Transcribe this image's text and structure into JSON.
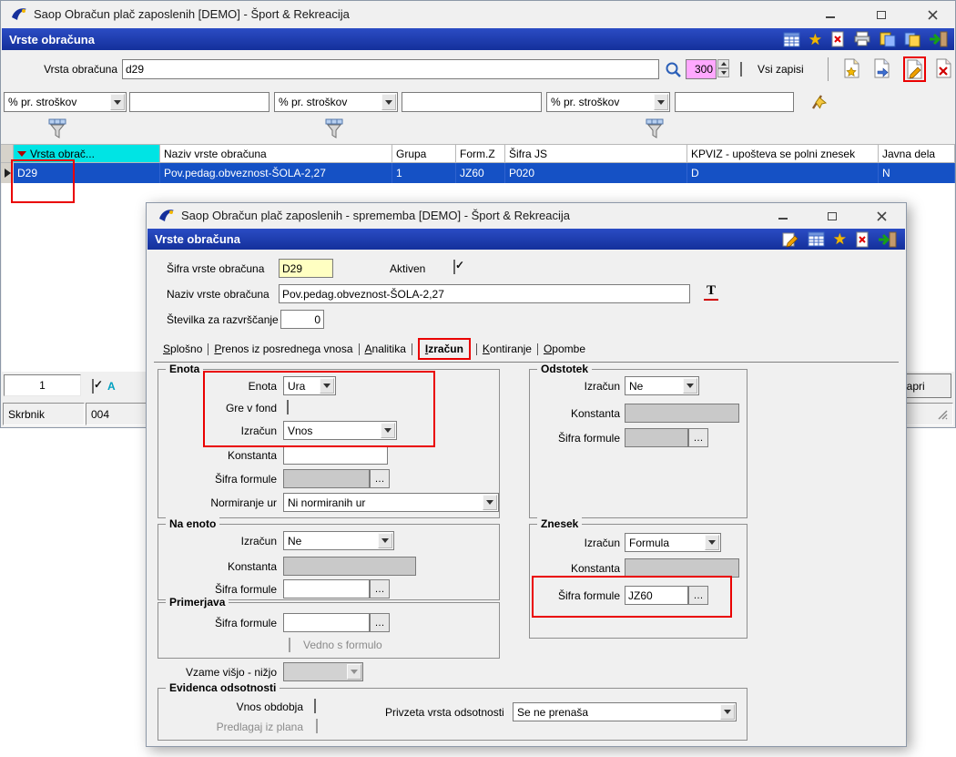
{
  "ui": {
    "ellipsis": "…",
    "t_glyph": "T"
  },
  "main_window": {
    "title": "Saop Obračun plač zaposlenih [DEMO] - Šport & Rekreacija",
    "panel_title": "Vrste obračuna",
    "search": {
      "label": "Vrsta obračuna",
      "value": "d29",
      "record_limit": "300",
      "all_records_label": "Vsi zapisi"
    },
    "filters": [
      {
        "selected": "% pr. stroškov",
        "value": ""
      },
      {
        "selected": "% pr. stroškov",
        "value": ""
      },
      {
        "selected": "% pr. stroškov",
        "value": ""
      }
    ],
    "grid": {
      "columns": [
        "Vrsta obrač...",
        "Naziv vrste obračuna",
        "Grupa",
        "Form.Z",
        "Šifra JS",
        "KPVIZ - upošteva se polni znesek",
        "Javna dela"
      ],
      "row": {
        "vrsta": "D29",
        "naziv": "Pov.pedag.obveznost-ŠOLA-2,27",
        "grupa": "1",
        "form_z": "JZ60",
        "sifra_js": "P020",
        "kpviz": "D",
        "javna": "N"
      }
    },
    "footer": {
      "record_count": "1",
      "active_label": "A",
      "a_checked": true,
      "close_button": "Zapri",
      "status_user": "Skrbnik",
      "status_code": "004"
    }
  },
  "dialog": {
    "title": "Saop Obračun plač zaposlenih - sprememba [DEMO] - Šport & Rekreacija",
    "panel_title": "Vrste obračuna",
    "fields": {
      "code_label": "Šifra vrste obračuna",
      "code_value": "D29",
      "active_label": "Aktiven",
      "active_checked": true,
      "name_label": "Naziv vrste obračuna",
      "name_value": "Pov.pedag.obveznost-ŠOLA-2,27",
      "sort_label": "Številka za razvrščanje",
      "sort_value": "0"
    },
    "tabs": [
      "Splošno",
      "Prenos iz posrednega vnosa",
      "Analitika",
      "Izračun",
      "Kontiranje",
      "Opombe"
    ],
    "active_tab": "Izračun",
    "enota": {
      "title": "Enota",
      "unit_label": "Enota",
      "unit_value": "Ura",
      "fond_label": "Gre v fond",
      "calc_label": "Izračun",
      "calc_value": "Vnos",
      "const_label": "Konstanta",
      "const_value": "",
      "formula_label": "Šifra formule",
      "formula_value": "",
      "norm_label": "Normiranje ur",
      "norm_value": "Ni normiranih ur"
    },
    "odstotek": {
      "title": "Odstotek",
      "calc_label": "Izračun",
      "calc_value": "Ne",
      "const_label": "Konstanta",
      "const_value": "",
      "formula_label": "Šifra formule",
      "formula_value": ""
    },
    "na_enoto": {
      "title": "Na enoto",
      "calc_label": "Izračun",
      "calc_value": "Ne",
      "const_label": "Konstanta",
      "const_value": "",
      "formula_label": "Šifra formule",
      "formula_value": ""
    },
    "primerjava": {
      "title": "Primerjava",
      "formula_label": "Šifra formule",
      "formula_value": "",
      "always_label": "Vedno s formulo"
    },
    "vzame_label": "Vzame višjo - nižjo",
    "znesek": {
      "title": "Znesek",
      "calc_label": "Izračun",
      "calc_value": "Formula",
      "const_label": "Konstanta",
      "const_value": "",
      "formula_label": "Šifra formule",
      "formula_value": "JZ60"
    },
    "evidenca": {
      "title": "Evidenca odsotnosti",
      "period_label": "Vnos obdobja",
      "plan_label": "Predlagaj iz plana",
      "default_label": "Privzeta vrsta odsotnosti",
      "default_value": "Se ne prenaša"
    }
  }
}
